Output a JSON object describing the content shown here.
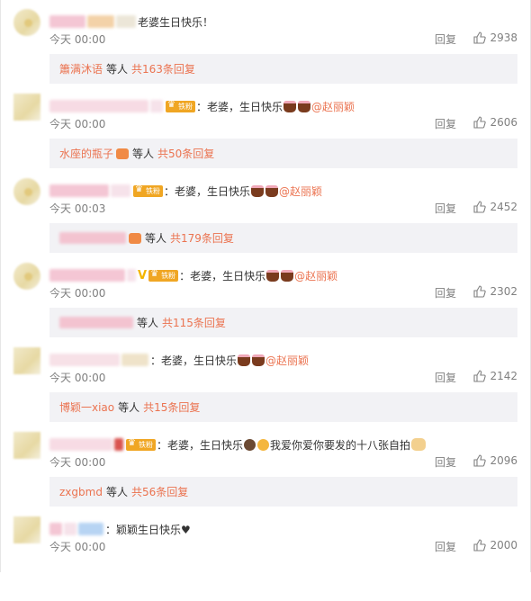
{
  "comments": [
    {
      "text": "老婆生日快乐！",
      "time": "今天 00:00",
      "reply_label": "回复",
      "likes": "2938",
      "sub": {
        "who": "簫满沐语",
        "mid": "等人",
        "total": "共163条回复"
      }
    },
    {
      "text": "：老婆，生日快乐",
      "mention": "@赵丽颖",
      "time": "今天 00:00",
      "reply_label": "回复",
      "likes": "2606",
      "sub": {
        "who": "水座的瓶子",
        "mid": "等人",
        "total": "共50条回复"
      }
    },
    {
      "text": "：老婆，生日快乐",
      "mention": "@赵丽颖",
      "time": "今天 00:03",
      "reply_label": "回复",
      "likes": "2452",
      "sub": {
        "who": "",
        "mid": "等人",
        "total": "共179条回复"
      }
    },
    {
      "text": "：老婆，生日快乐",
      "mention": "@赵丽颖",
      "time": "今天 00:00",
      "reply_label": "回复",
      "likes": "2302",
      "sub": {
        "who": "",
        "mid": "等人",
        "total": "共115条回复"
      }
    },
    {
      "text": "：老婆，生日快乐",
      "mention": "@赵丽颖",
      "time": "今天 00:00",
      "reply_label": "回复",
      "likes": "2142",
      "sub": {
        "who": "博颖一xiao",
        "mid": "等人",
        "total": "共15条回复"
      }
    },
    {
      "text": "：老婆，生日快乐",
      "text2": "我爱你爱你要发的十八张自拍",
      "time": "今天 00:00",
      "reply_label": "回复",
      "likes": "2096",
      "sub": {
        "who": "zxgbmd",
        "mid": "等人",
        "total": "共56条回复"
      }
    },
    {
      "text": "：颖颖生日快乐♥",
      "time": "今天 00:00",
      "reply_label": "回复",
      "likes": "2000"
    }
  ],
  "badge_label": "铁粉",
  "colors": {
    "accent": "#eb7350",
    "sub_bg": "#f2f2f5",
    "meta": "#808080"
  }
}
